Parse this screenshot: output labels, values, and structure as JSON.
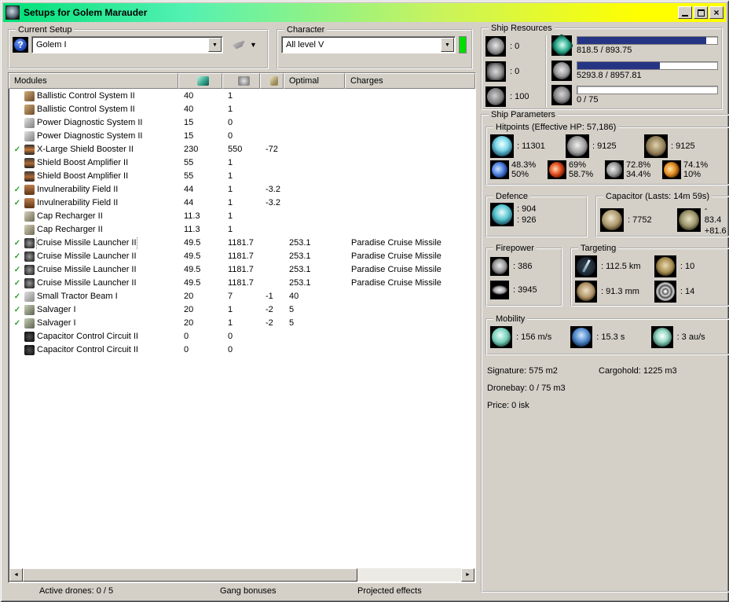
{
  "window": {
    "title": "Setups for Golem Marauder"
  },
  "current_setup": {
    "label": "Current Setup",
    "value": "Golem I"
  },
  "character": {
    "label": "Character",
    "value": "All level V"
  },
  "colors": {
    "titlebar_left": "#00DF78",
    "titlebar_mid": "#52F1B2",
    "titlebar_right": "#FFFF00",
    "bar_fill": "#263583",
    "active_check": "#2E9E2E",
    "character_status": "#00DD00"
  },
  "ship_resources": {
    "label": "Ship Resources",
    "turrets": ": 0",
    "launchers": ": 0",
    "calibration": ": 100",
    "bars": [
      {
        "name": "cpu",
        "text": "818.5 / 893.75",
        "pct": 92
      },
      {
        "name": "powergrid",
        "text": "5293.8 / 8957.81",
        "pct": 59
      },
      {
        "name": "dronebay",
        "text": "0 / 75",
        "pct": 0
      }
    ]
  },
  "modules": {
    "header": {
      "name": "Modules",
      "optimal": "Optimal",
      "charges": "Charges"
    },
    "rows": [
      {
        "active": false,
        "selected": false,
        "icon": "bcs",
        "name": "Ballistic Control System II",
        "cpu": "40",
        "pg": "1",
        "cap": "",
        "optimal": "",
        "charges": ""
      },
      {
        "active": false,
        "selected": false,
        "icon": "bcs",
        "name": "Ballistic Control System II",
        "cpu": "40",
        "pg": "1",
        "cap": "",
        "optimal": "",
        "charges": ""
      },
      {
        "active": false,
        "selected": false,
        "icon": "pds",
        "name": "Power Diagnostic System II",
        "cpu": "15",
        "pg": "0",
        "cap": "",
        "optimal": "",
        "charges": ""
      },
      {
        "active": false,
        "selected": false,
        "icon": "pds",
        "name": "Power Diagnostic System II",
        "cpu": "15",
        "pg": "0",
        "cap": "",
        "optimal": "",
        "charges": ""
      },
      {
        "active": true,
        "selected": false,
        "icon": "booster",
        "name": "X-Large Shield Booster II",
        "cpu": "230",
        "pg": "550",
        "cap": "-72",
        "optimal": "",
        "charges": ""
      },
      {
        "active": false,
        "selected": false,
        "icon": "sba",
        "name": "Shield Boost Amplifier II",
        "cpu": "55",
        "pg": "1",
        "cap": "",
        "optimal": "",
        "charges": ""
      },
      {
        "active": false,
        "selected": false,
        "icon": "sba",
        "name": "Shield Boost Amplifier II",
        "cpu": "55",
        "pg": "1",
        "cap": "",
        "optimal": "",
        "charges": ""
      },
      {
        "active": true,
        "selected": false,
        "icon": "invuln",
        "name": "Invulnerability Field II",
        "cpu": "44",
        "pg": "1",
        "cap": "-3.2",
        "optimal": "",
        "charges": ""
      },
      {
        "active": true,
        "selected": false,
        "icon": "invuln",
        "name": "Invulnerability Field II",
        "cpu": "44",
        "pg": "1",
        "cap": "-3.2",
        "optimal": "",
        "charges": ""
      },
      {
        "active": false,
        "selected": false,
        "icon": "capre",
        "name": "Cap Recharger II",
        "cpu": "11.3",
        "pg": "1",
        "cap": "",
        "optimal": "",
        "charges": ""
      },
      {
        "active": false,
        "selected": false,
        "icon": "capre",
        "name": "Cap Recharger II",
        "cpu": "11.3",
        "pg": "1",
        "cap": "",
        "optimal": "",
        "charges": ""
      },
      {
        "active": true,
        "selected": true,
        "icon": "cml",
        "name": "Cruise Missile Launcher II",
        "cpu": "49.5",
        "pg": "1181.7",
        "cap": "",
        "optimal": "253.1",
        "charges": "Paradise Cruise Missile"
      },
      {
        "active": true,
        "selected": false,
        "icon": "cml",
        "name": "Cruise Missile Launcher II",
        "cpu": "49.5",
        "pg": "1181.7",
        "cap": "",
        "optimal": "253.1",
        "charges": "Paradise Cruise Missile"
      },
      {
        "active": true,
        "selected": false,
        "icon": "cml",
        "name": "Cruise Missile Launcher II",
        "cpu": "49.5",
        "pg": "1181.7",
        "cap": "",
        "optimal": "253.1",
        "charges": "Paradise Cruise Missile"
      },
      {
        "active": true,
        "selected": false,
        "icon": "cml",
        "name": "Cruise Missile Launcher II",
        "cpu": "49.5",
        "pg": "1181.7",
        "cap": "",
        "optimal": "253.1",
        "charges": "Paradise Cruise Missile"
      },
      {
        "active": true,
        "selected": false,
        "icon": "tractor",
        "name": "Small Tractor Beam I",
        "cpu": "20",
        "pg": "7",
        "cap": "-1",
        "optimal": "40",
        "charges": ""
      },
      {
        "active": true,
        "selected": false,
        "icon": "salv",
        "name": "Salvager I",
        "cpu": "20",
        "pg": "1",
        "cap": "-2",
        "optimal": "5",
        "charges": ""
      },
      {
        "active": true,
        "selected": false,
        "icon": "salv",
        "name": "Salvager I",
        "cpu": "20",
        "pg": "1",
        "cap": "-2",
        "optimal": "5",
        "charges": ""
      },
      {
        "active": false,
        "selected": false,
        "icon": "ccc",
        "name": "Capacitor Control Circuit II",
        "cpu": "0",
        "pg": "0",
        "cap": "",
        "optimal": "",
        "charges": ""
      },
      {
        "active": false,
        "selected": false,
        "icon": "ccc",
        "name": "Capacitor Control Circuit II",
        "cpu": "0",
        "pg": "0",
        "cap": "",
        "optimal": "",
        "charges": ""
      }
    ]
  },
  "ship_parameters": {
    "label": "Ship Parameters",
    "hitpoints": {
      "label": "Hitpoints (Effective HP: 57,186)",
      "shield": ": 11301",
      "armor": ": 9125",
      "structure": ": 9125",
      "resists": [
        {
          "name": "em",
          "shield": "48.3%",
          "armor": "50%"
        },
        {
          "name": "thermal",
          "shield": "69%",
          "armor": "58.7%"
        },
        {
          "name": "kinetic",
          "shield": "72.8%",
          "armor": "34.4%"
        },
        {
          "name": "explosive",
          "shield": "74.1%",
          "armor": "10%"
        }
      ]
    },
    "defence": {
      "label": "Defence",
      "line1": ": 904",
      "line2": ": 926"
    },
    "capacitor": {
      "label": "Capacitor (Lasts: 14m 59s)",
      "amount": ": 7752",
      "drain": "- 83.4",
      "recharge": "+81.6"
    },
    "firepower": {
      "label": "Firepower",
      "turret": ": 386",
      "missile": ": 3945"
    },
    "targeting": {
      "label": "Targeting",
      "range": ": 112.5 km",
      "scan_res": ": 91.3 mm",
      "max_targets": ": 10",
      "sensor_strength": ": 14"
    },
    "mobility": {
      "label": "Mobility",
      "velocity": ": 156 m/s",
      "align_time": ": 15.3 s",
      "warp_speed": ": 3 au/s"
    },
    "stats": {
      "signature": "Signature: 575 m2",
      "cargohold": "Cargohold: 1225 m3",
      "dronebay": "Dronebay: 0 / 75 m3",
      "price": "Price: 0 isk"
    }
  },
  "footer": {
    "active_drones": "Active drones: 0 / 5",
    "gang_bonuses": "Gang bonuses",
    "projected_effects": "Projected effects"
  }
}
